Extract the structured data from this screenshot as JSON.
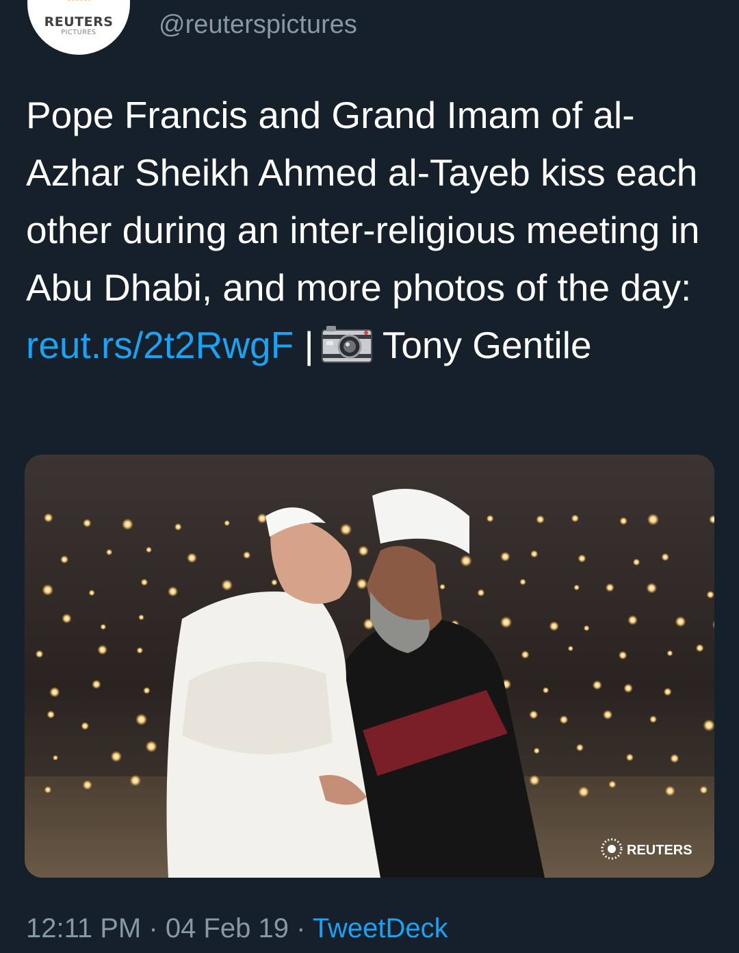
{
  "account": {
    "avatar_brand": "REUTERS",
    "avatar_sub": "PICTURES",
    "handle": "@reuterspictures"
  },
  "tweet": {
    "text": "Pope Francis and Grand Imam of al-Azhar Sheikh Ahmed al-Tayeb kiss each other during an inter-religious meeting in Abu Dhabi, and more photos of the day:",
    "link": "reut.rs/2t2RwgF",
    "separator": "|",
    "camera_icon": "camera-emoji-icon",
    "credit": "Tony Gentile"
  },
  "photo": {
    "watermark": "REUTERS"
  },
  "footer": {
    "time": "12:11 PM",
    "dot1": "·",
    "date": "04 Feb 19",
    "dot2": "·",
    "source": "TweetDeck"
  },
  "colors": {
    "background": "#15202b",
    "text": "#ffffff",
    "secondary": "#8899a6",
    "link": "#1da1f2"
  }
}
